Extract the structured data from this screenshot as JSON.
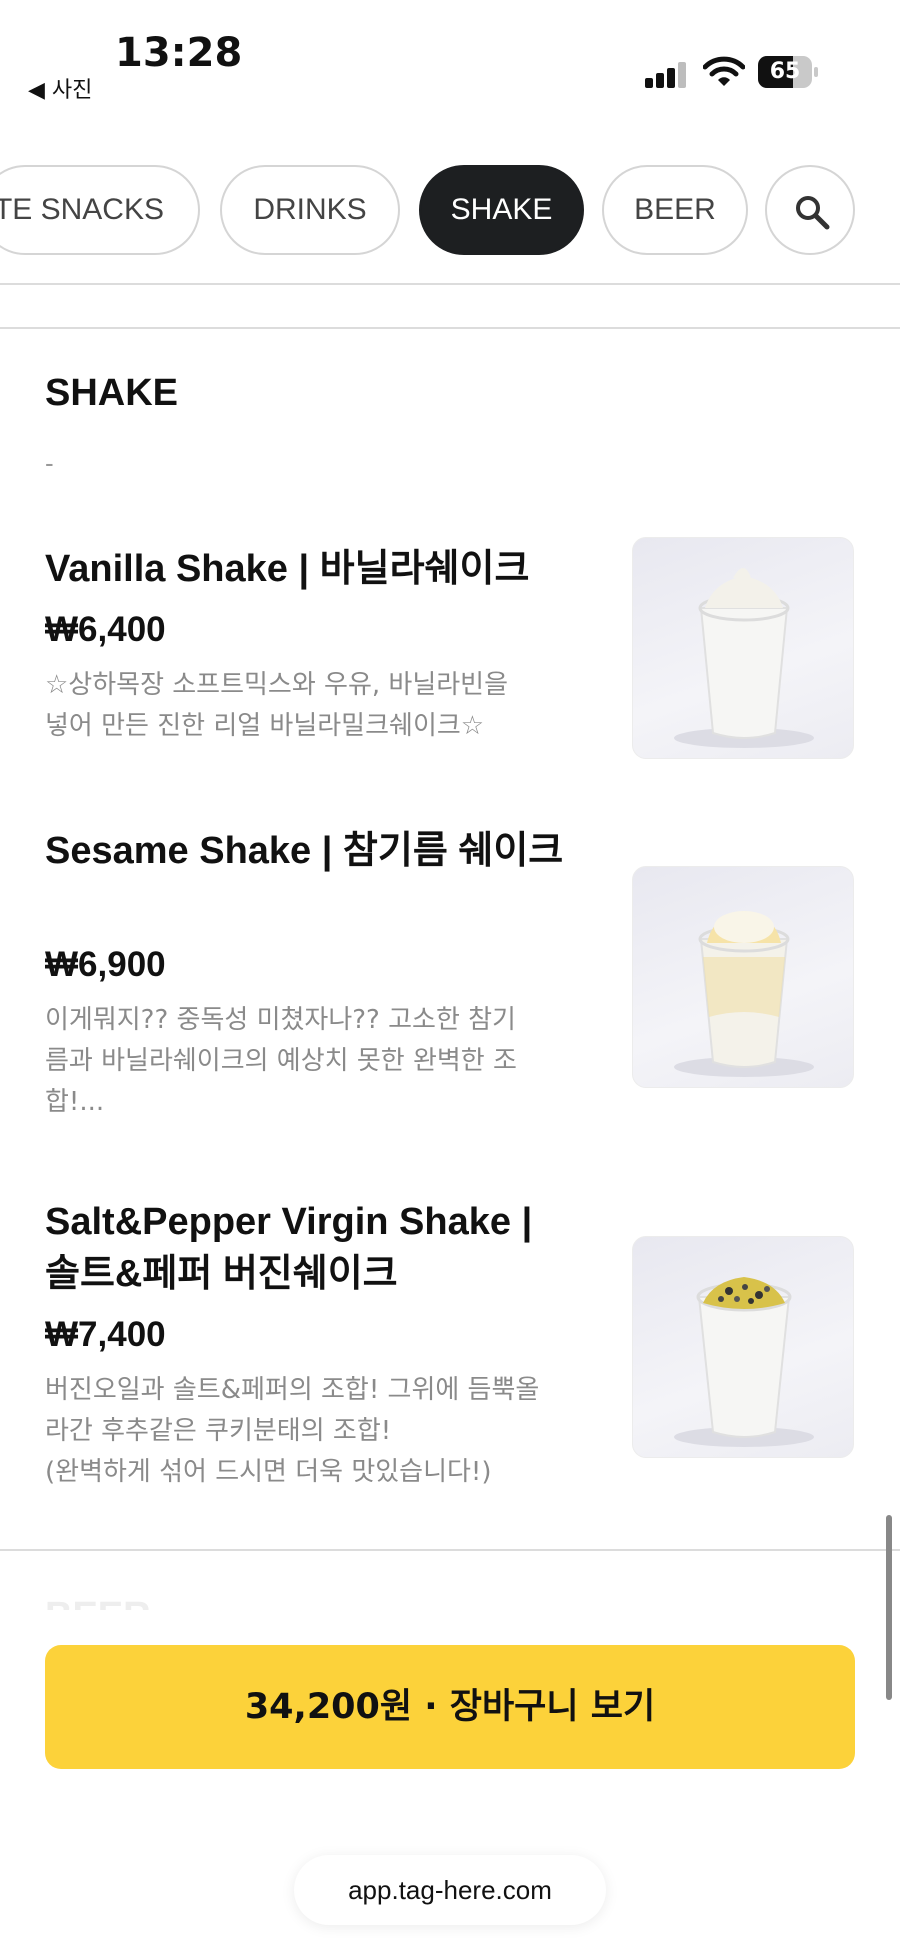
{
  "status_bar": {
    "time": "13:28",
    "back_app": "◀ 사진",
    "battery": "65",
    "battery_level": 0.65
  },
  "tabs": [
    {
      "label": "TE SNACKS",
      "active": false
    },
    {
      "label": "DRINKS",
      "active": false
    },
    {
      "label": "SHAKE",
      "active": true
    },
    {
      "label": "BEER",
      "active": false
    }
  ],
  "section": {
    "title": "SHAKE",
    "description": "-"
  },
  "menu_items": [
    {
      "name": "Vanilla Shake | 바닐라쉐이크",
      "price": "₩6,400",
      "description": "☆상하목장 소프트믹스와 우유, 바닐라빈을\n넣어 만든 진한 리얼 바닐라밀크쉐이크☆",
      "topping_color": "#f3f1ea"
    },
    {
      "name": "Sesame Shake | 참기름 쉐이크",
      "price": "₩6,900",
      "description": "이게뭐지?? 중독성 미쳤자나?? 고소한 참기\n름과 바닐라쉐이크의 예상치 못한 완벽한 조\n합!...",
      "topping_color": "#f6e3a8"
    },
    {
      "name": "Salt&Pepper Virgin Shake | 솔트&페퍼 버진쉐이크",
      "price": "₩7,400",
      "description": "버진오일과 솔트&페퍼의 조합! 그위에 듬뿍올\n라간 후추같은 쿠키분태의 조합!\n(완벽하게 섞어 드시면 더욱 맛있습니다!)",
      "topping_color": "#d8c24a"
    }
  ],
  "next_section_peek": "BEER",
  "cart_button": "34,200원 · 장바구니 보기",
  "url": "app.tag-here.com"
}
